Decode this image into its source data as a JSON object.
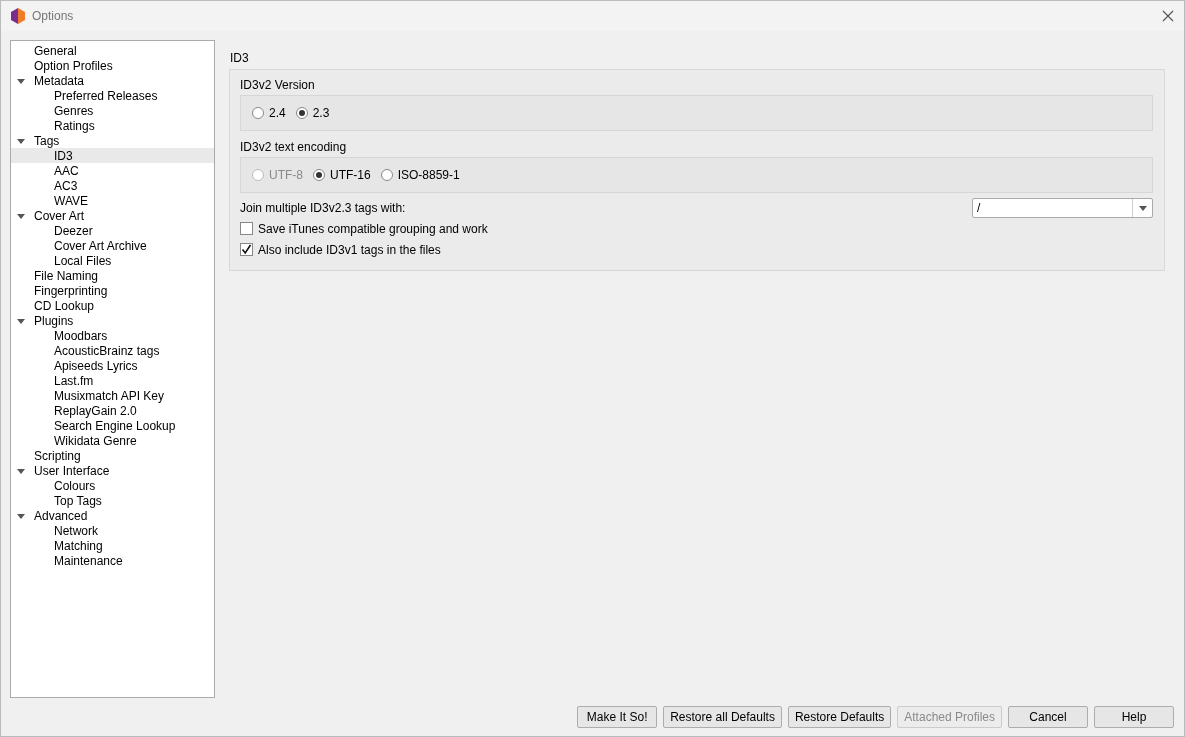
{
  "window": {
    "title": "Options"
  },
  "tree": [
    {
      "label": "General",
      "selected": false
    },
    {
      "label": "Option Profiles",
      "selected": false
    },
    {
      "label": "Metadata",
      "selected": false,
      "expanded": true,
      "children": [
        {
          "label": "Preferred Releases",
          "selected": false
        },
        {
          "label": "Genres",
          "selected": false
        },
        {
          "label": "Ratings",
          "selected": false
        }
      ]
    },
    {
      "label": "Tags",
      "selected": false,
      "expanded": true,
      "children": [
        {
          "label": "ID3",
          "selected": true
        },
        {
          "label": "AAC",
          "selected": false
        },
        {
          "label": "AC3",
          "selected": false
        },
        {
          "label": "WAVE",
          "selected": false
        }
      ]
    },
    {
      "label": "Cover Art",
      "selected": false,
      "expanded": true,
      "children": [
        {
          "label": "Deezer",
          "selected": false
        },
        {
          "label": "Cover Art Archive",
          "selected": false
        },
        {
          "label": "Local Files",
          "selected": false
        }
      ]
    },
    {
      "label": "File Naming",
      "selected": false
    },
    {
      "label": "Fingerprinting",
      "selected": false
    },
    {
      "label": "CD Lookup",
      "selected": false
    },
    {
      "label": "Plugins",
      "selected": false,
      "expanded": true,
      "children": [
        {
          "label": "Moodbars",
          "selected": false
        },
        {
          "label": "AcousticBrainz tags",
          "selected": false
        },
        {
          "label": "Apiseeds Lyrics",
          "selected": false
        },
        {
          "label": "Last.fm",
          "selected": false
        },
        {
          "label": "Musixmatch API Key",
          "selected": false
        },
        {
          "label": "ReplayGain 2.0",
          "selected": false
        },
        {
          "label": "Search Engine Lookup",
          "selected": false
        },
        {
          "label": "Wikidata Genre",
          "selected": false
        }
      ]
    },
    {
      "label": "Scripting",
      "selected": false
    },
    {
      "label": "User Interface",
      "selected": false,
      "expanded": true,
      "children": [
        {
          "label": "Colours",
          "selected": false
        },
        {
          "label": "Top Tags",
          "selected": false
        }
      ]
    },
    {
      "label": "Advanced",
      "selected": false,
      "expanded": true,
      "children": [
        {
          "label": "Network",
          "selected": false
        },
        {
          "label": "Matching",
          "selected": false
        },
        {
          "label": "Maintenance",
          "selected": false
        }
      ]
    }
  ],
  "page": {
    "title": "ID3",
    "groups": [
      {
        "title": "ID3v2 Version",
        "options": [
          {
            "label": "2.4",
            "selected": false,
            "disabled": false
          },
          {
            "label": "2.3",
            "selected": true,
            "disabled": false
          }
        ]
      },
      {
        "title": "ID3v2 text encoding",
        "options": [
          {
            "label": "UTF-8",
            "selected": false,
            "disabled": true
          },
          {
            "label": "UTF-16",
            "selected": true,
            "disabled": false
          },
          {
            "label": "ISO-8859-1",
            "selected": false,
            "disabled": false
          }
        ]
      }
    ],
    "join": {
      "label": "Join multiple ID3v2.3 tags with:",
      "value": "/"
    },
    "checkboxes": [
      {
        "label": "Save iTunes compatible grouping and work",
        "checked": false
      },
      {
        "label": "Also include ID3v1 tags in the files",
        "checked": true
      }
    ]
  },
  "buttons": [
    {
      "label": "Make It So!",
      "disabled": false
    },
    {
      "label": "Restore all Defaults",
      "disabled": false
    },
    {
      "label": "Restore Defaults",
      "disabled": false
    },
    {
      "label": "Attached Profiles",
      "disabled": true
    },
    {
      "label": "Cancel",
      "disabled": false
    },
    {
      "label": "Help",
      "disabled": false
    }
  ]
}
